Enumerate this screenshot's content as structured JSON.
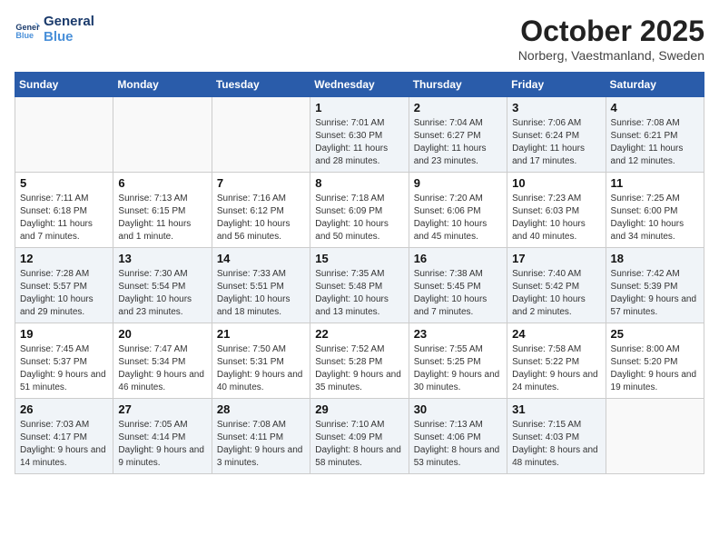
{
  "logo": {
    "line1": "General",
    "line2": "Blue"
  },
  "title": "October 2025",
  "subtitle": "Norberg, Vaestmanland, Sweden",
  "days_header": [
    "Sunday",
    "Monday",
    "Tuesday",
    "Wednesday",
    "Thursday",
    "Friday",
    "Saturday"
  ],
  "weeks": [
    [
      {
        "day": "",
        "sunrise": "",
        "sunset": "",
        "daylight": ""
      },
      {
        "day": "",
        "sunrise": "",
        "sunset": "",
        "daylight": ""
      },
      {
        "day": "",
        "sunrise": "",
        "sunset": "",
        "daylight": ""
      },
      {
        "day": "1",
        "sunrise": "Sunrise: 7:01 AM",
        "sunset": "Sunset: 6:30 PM",
        "daylight": "Daylight: 11 hours and 28 minutes."
      },
      {
        "day": "2",
        "sunrise": "Sunrise: 7:04 AM",
        "sunset": "Sunset: 6:27 PM",
        "daylight": "Daylight: 11 hours and 23 minutes."
      },
      {
        "day": "3",
        "sunrise": "Sunrise: 7:06 AM",
        "sunset": "Sunset: 6:24 PM",
        "daylight": "Daylight: 11 hours and 17 minutes."
      },
      {
        "day": "4",
        "sunrise": "Sunrise: 7:08 AM",
        "sunset": "Sunset: 6:21 PM",
        "daylight": "Daylight: 11 hours and 12 minutes."
      }
    ],
    [
      {
        "day": "5",
        "sunrise": "Sunrise: 7:11 AM",
        "sunset": "Sunset: 6:18 PM",
        "daylight": "Daylight: 11 hours and 7 minutes."
      },
      {
        "day": "6",
        "sunrise": "Sunrise: 7:13 AM",
        "sunset": "Sunset: 6:15 PM",
        "daylight": "Daylight: 11 hours and 1 minute."
      },
      {
        "day": "7",
        "sunrise": "Sunrise: 7:16 AM",
        "sunset": "Sunset: 6:12 PM",
        "daylight": "Daylight: 10 hours and 56 minutes."
      },
      {
        "day": "8",
        "sunrise": "Sunrise: 7:18 AM",
        "sunset": "Sunset: 6:09 PM",
        "daylight": "Daylight: 10 hours and 50 minutes."
      },
      {
        "day": "9",
        "sunrise": "Sunrise: 7:20 AM",
        "sunset": "Sunset: 6:06 PM",
        "daylight": "Daylight: 10 hours and 45 minutes."
      },
      {
        "day": "10",
        "sunrise": "Sunrise: 7:23 AM",
        "sunset": "Sunset: 6:03 PM",
        "daylight": "Daylight: 10 hours and 40 minutes."
      },
      {
        "day": "11",
        "sunrise": "Sunrise: 7:25 AM",
        "sunset": "Sunset: 6:00 PM",
        "daylight": "Daylight: 10 hours and 34 minutes."
      }
    ],
    [
      {
        "day": "12",
        "sunrise": "Sunrise: 7:28 AM",
        "sunset": "Sunset: 5:57 PM",
        "daylight": "Daylight: 10 hours and 29 minutes."
      },
      {
        "day": "13",
        "sunrise": "Sunrise: 7:30 AM",
        "sunset": "Sunset: 5:54 PM",
        "daylight": "Daylight: 10 hours and 23 minutes."
      },
      {
        "day": "14",
        "sunrise": "Sunrise: 7:33 AM",
        "sunset": "Sunset: 5:51 PM",
        "daylight": "Daylight: 10 hours and 18 minutes."
      },
      {
        "day": "15",
        "sunrise": "Sunrise: 7:35 AM",
        "sunset": "Sunset: 5:48 PM",
        "daylight": "Daylight: 10 hours and 13 minutes."
      },
      {
        "day": "16",
        "sunrise": "Sunrise: 7:38 AM",
        "sunset": "Sunset: 5:45 PM",
        "daylight": "Daylight: 10 hours and 7 minutes."
      },
      {
        "day": "17",
        "sunrise": "Sunrise: 7:40 AM",
        "sunset": "Sunset: 5:42 PM",
        "daylight": "Daylight: 10 hours and 2 minutes."
      },
      {
        "day": "18",
        "sunrise": "Sunrise: 7:42 AM",
        "sunset": "Sunset: 5:39 PM",
        "daylight": "Daylight: 9 hours and 57 minutes."
      }
    ],
    [
      {
        "day": "19",
        "sunrise": "Sunrise: 7:45 AM",
        "sunset": "Sunset: 5:37 PM",
        "daylight": "Daylight: 9 hours and 51 minutes."
      },
      {
        "day": "20",
        "sunrise": "Sunrise: 7:47 AM",
        "sunset": "Sunset: 5:34 PM",
        "daylight": "Daylight: 9 hours and 46 minutes."
      },
      {
        "day": "21",
        "sunrise": "Sunrise: 7:50 AM",
        "sunset": "Sunset: 5:31 PM",
        "daylight": "Daylight: 9 hours and 40 minutes."
      },
      {
        "day": "22",
        "sunrise": "Sunrise: 7:52 AM",
        "sunset": "Sunset: 5:28 PM",
        "daylight": "Daylight: 9 hours and 35 minutes."
      },
      {
        "day": "23",
        "sunrise": "Sunrise: 7:55 AM",
        "sunset": "Sunset: 5:25 PM",
        "daylight": "Daylight: 9 hours and 30 minutes."
      },
      {
        "day": "24",
        "sunrise": "Sunrise: 7:58 AM",
        "sunset": "Sunset: 5:22 PM",
        "daylight": "Daylight: 9 hours and 24 minutes."
      },
      {
        "day": "25",
        "sunrise": "Sunrise: 8:00 AM",
        "sunset": "Sunset: 5:20 PM",
        "daylight": "Daylight: 9 hours and 19 minutes."
      }
    ],
    [
      {
        "day": "26",
        "sunrise": "Sunrise: 7:03 AM",
        "sunset": "Sunset: 4:17 PM",
        "daylight": "Daylight: 9 hours and 14 minutes."
      },
      {
        "day": "27",
        "sunrise": "Sunrise: 7:05 AM",
        "sunset": "Sunset: 4:14 PM",
        "daylight": "Daylight: 9 hours and 9 minutes."
      },
      {
        "day": "28",
        "sunrise": "Sunrise: 7:08 AM",
        "sunset": "Sunset: 4:11 PM",
        "daylight": "Daylight: 9 hours and 3 minutes."
      },
      {
        "day": "29",
        "sunrise": "Sunrise: 7:10 AM",
        "sunset": "Sunset: 4:09 PM",
        "daylight": "Daylight: 8 hours and 58 minutes."
      },
      {
        "day": "30",
        "sunrise": "Sunrise: 7:13 AM",
        "sunset": "Sunset: 4:06 PM",
        "daylight": "Daylight: 8 hours and 53 minutes."
      },
      {
        "day": "31",
        "sunrise": "Sunrise: 7:15 AM",
        "sunset": "Sunset: 4:03 PM",
        "daylight": "Daylight: 8 hours and 48 minutes."
      },
      {
        "day": "",
        "sunrise": "",
        "sunset": "",
        "daylight": ""
      }
    ]
  ]
}
